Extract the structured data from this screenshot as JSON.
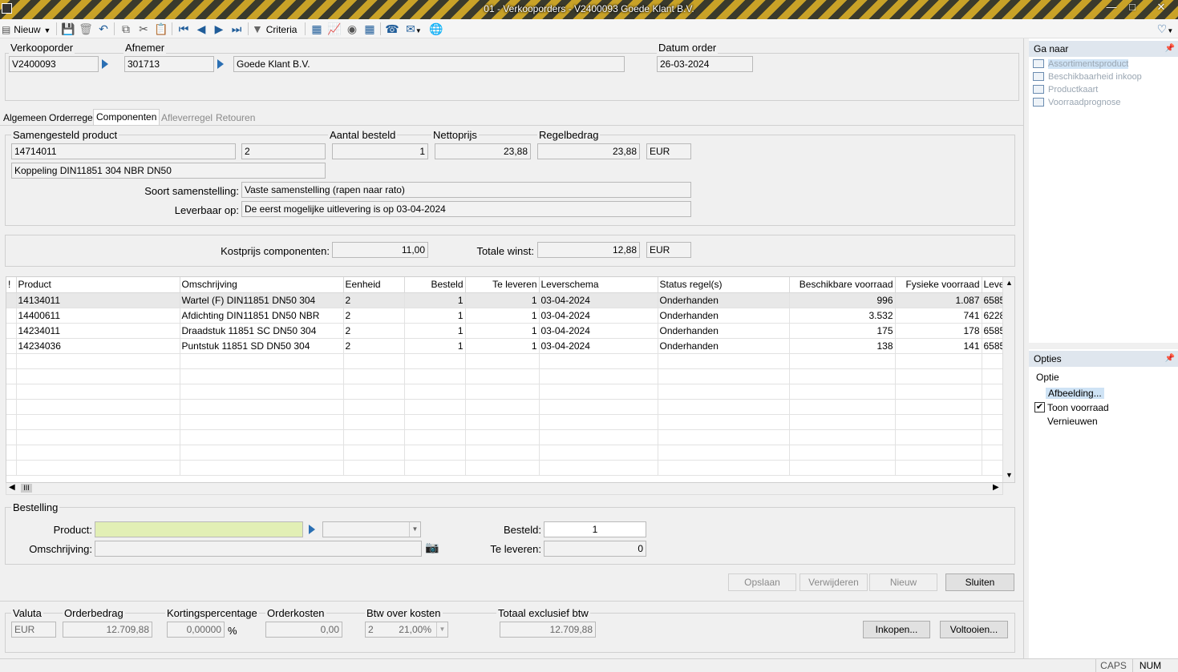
{
  "window": {
    "title": "01 - Verkooporders - V2400093 Goede Klant B.V.",
    "minimize": "—",
    "maximize": "□",
    "close": "✕"
  },
  "toolbar": {
    "new_label": "Nieuw",
    "criteria_label": "Criteria"
  },
  "header": {
    "verkooporder_label": "Verkooporder",
    "verkooporder_value": "V2400093",
    "afnemer_label": "Afnemer",
    "afnemer_code": "301713",
    "afnemer_name": "Goede Klant B.V.",
    "datum_label": "Datum order",
    "datum_value": "26-03-2024"
  },
  "tabs": [
    {
      "label": "Algemeen",
      "state": "normal"
    },
    {
      "label": "Orderregel",
      "state": "normal"
    },
    {
      "label": "Componenten",
      "state": "active"
    },
    {
      "label": "Afleverregel",
      "state": "disabled"
    },
    {
      "label": "Retouren",
      "state": "disabled"
    }
  ],
  "composite": {
    "product_label": "Samengesteld product",
    "product_code": "14714011",
    "unit": "2",
    "aantal_label": "Aantal besteld",
    "aantal_value": "1",
    "netto_label": "Nettoprijs",
    "netto_value": "23,88",
    "regel_label": "Regelbedrag",
    "regel_value": "23,88",
    "currency": "EUR",
    "description": "Koppeling DIN11851 304 NBR DN50",
    "soort_label": "Soort samenstelling:",
    "soort_value": "Vaste samenstelling (rapen naar rato)",
    "leverbaar_label": "Leverbaar op:",
    "leverbaar_value": "De eerst mogelijke uitlevering is op 03-04-2024"
  },
  "costs": {
    "kostprijs_label": "Kostprijs componenten:",
    "kostprijs_value": "11,00",
    "winst_label": "Totale winst:",
    "winst_value": "12,88",
    "currency": "EUR"
  },
  "grid": {
    "columns": [
      "!",
      "Product",
      "Omschrijving",
      "Eenheid",
      "Besteld",
      "Te leveren",
      "Leverschema",
      "Status regel(s)",
      "Beschikbare voorraad",
      "Fysieke voorraad",
      "Leve"
    ],
    "rows": [
      [
        "",
        "14134011",
        "Wartel (F) DIN11851 DN50 304",
        "2",
        "1",
        "1",
        "03-04-2024",
        "Onderhanden",
        "996",
        "1.087",
        "6585"
      ],
      [
        "",
        "14400611",
        "Afdichting DIN11851 DN50 NBR",
        "2",
        "1",
        "1",
        "03-04-2024",
        "Onderhanden",
        "3.532",
        "741",
        "6228"
      ],
      [
        "",
        "14234011",
        "Draadstuk 11851 SC DN50 304",
        "2",
        "1",
        "1",
        "03-04-2024",
        "Onderhanden",
        "175",
        "178",
        "6585"
      ],
      [
        "",
        "14234036",
        "Puntstuk 11851 SD DN50 304",
        "2",
        "1",
        "1",
        "03-04-2024",
        "Onderhanden",
        "138",
        "141",
        "6585"
      ]
    ],
    "empty_rows": 8,
    "hscroll_thumb": "III"
  },
  "bestelling": {
    "title": "Bestelling",
    "product_label": "Product:",
    "product_value": "",
    "omschrijving_label": "Omschrijving:",
    "omschrijving_value": "",
    "besteld_label": "Besteld:",
    "besteld_value": "1",
    "televeren_label": "Te leveren:",
    "televeren_value": "0"
  },
  "actions": {
    "opslaan": "Opslaan",
    "verwijderen": "Verwijderen",
    "nieuw": "Nieuw",
    "sluiten": "Sluiten"
  },
  "footer": {
    "valuta_label": "Valuta",
    "valuta_value": "EUR",
    "orderbedrag_label": "Orderbedrag",
    "orderbedrag_value": "12.709,88",
    "korting_label": "Kortingspercentage",
    "korting_value": "0,00000",
    "korting_unit": "%",
    "orderkosten_label": "Orderkosten",
    "orderkosten_value": "0,00",
    "btw_label": "Btw over kosten",
    "btw_code": "2",
    "btw_value": "21,00%",
    "totaal_label": "Totaal exclusief btw",
    "totaal_value": "12.709,88",
    "inkopen": "Inkopen...",
    "voltooien": "Voltooien..."
  },
  "goto_panel": {
    "title": "Ga naar",
    "items": [
      "Assortimentsproduct",
      "Beschikbaarheid inkoop",
      "Productkaart",
      "Voorraadprognose"
    ]
  },
  "options_panel": {
    "title": "Opties",
    "subtitle": "Optie",
    "afbeelding": "Afbeelding...",
    "toon_voorraad": "Toon voorraad",
    "toon_voorraad_checked": true,
    "vernieuwen": "Vernieuwen"
  },
  "statusbar": {
    "caps": "CAPS",
    "num": "NUM"
  }
}
